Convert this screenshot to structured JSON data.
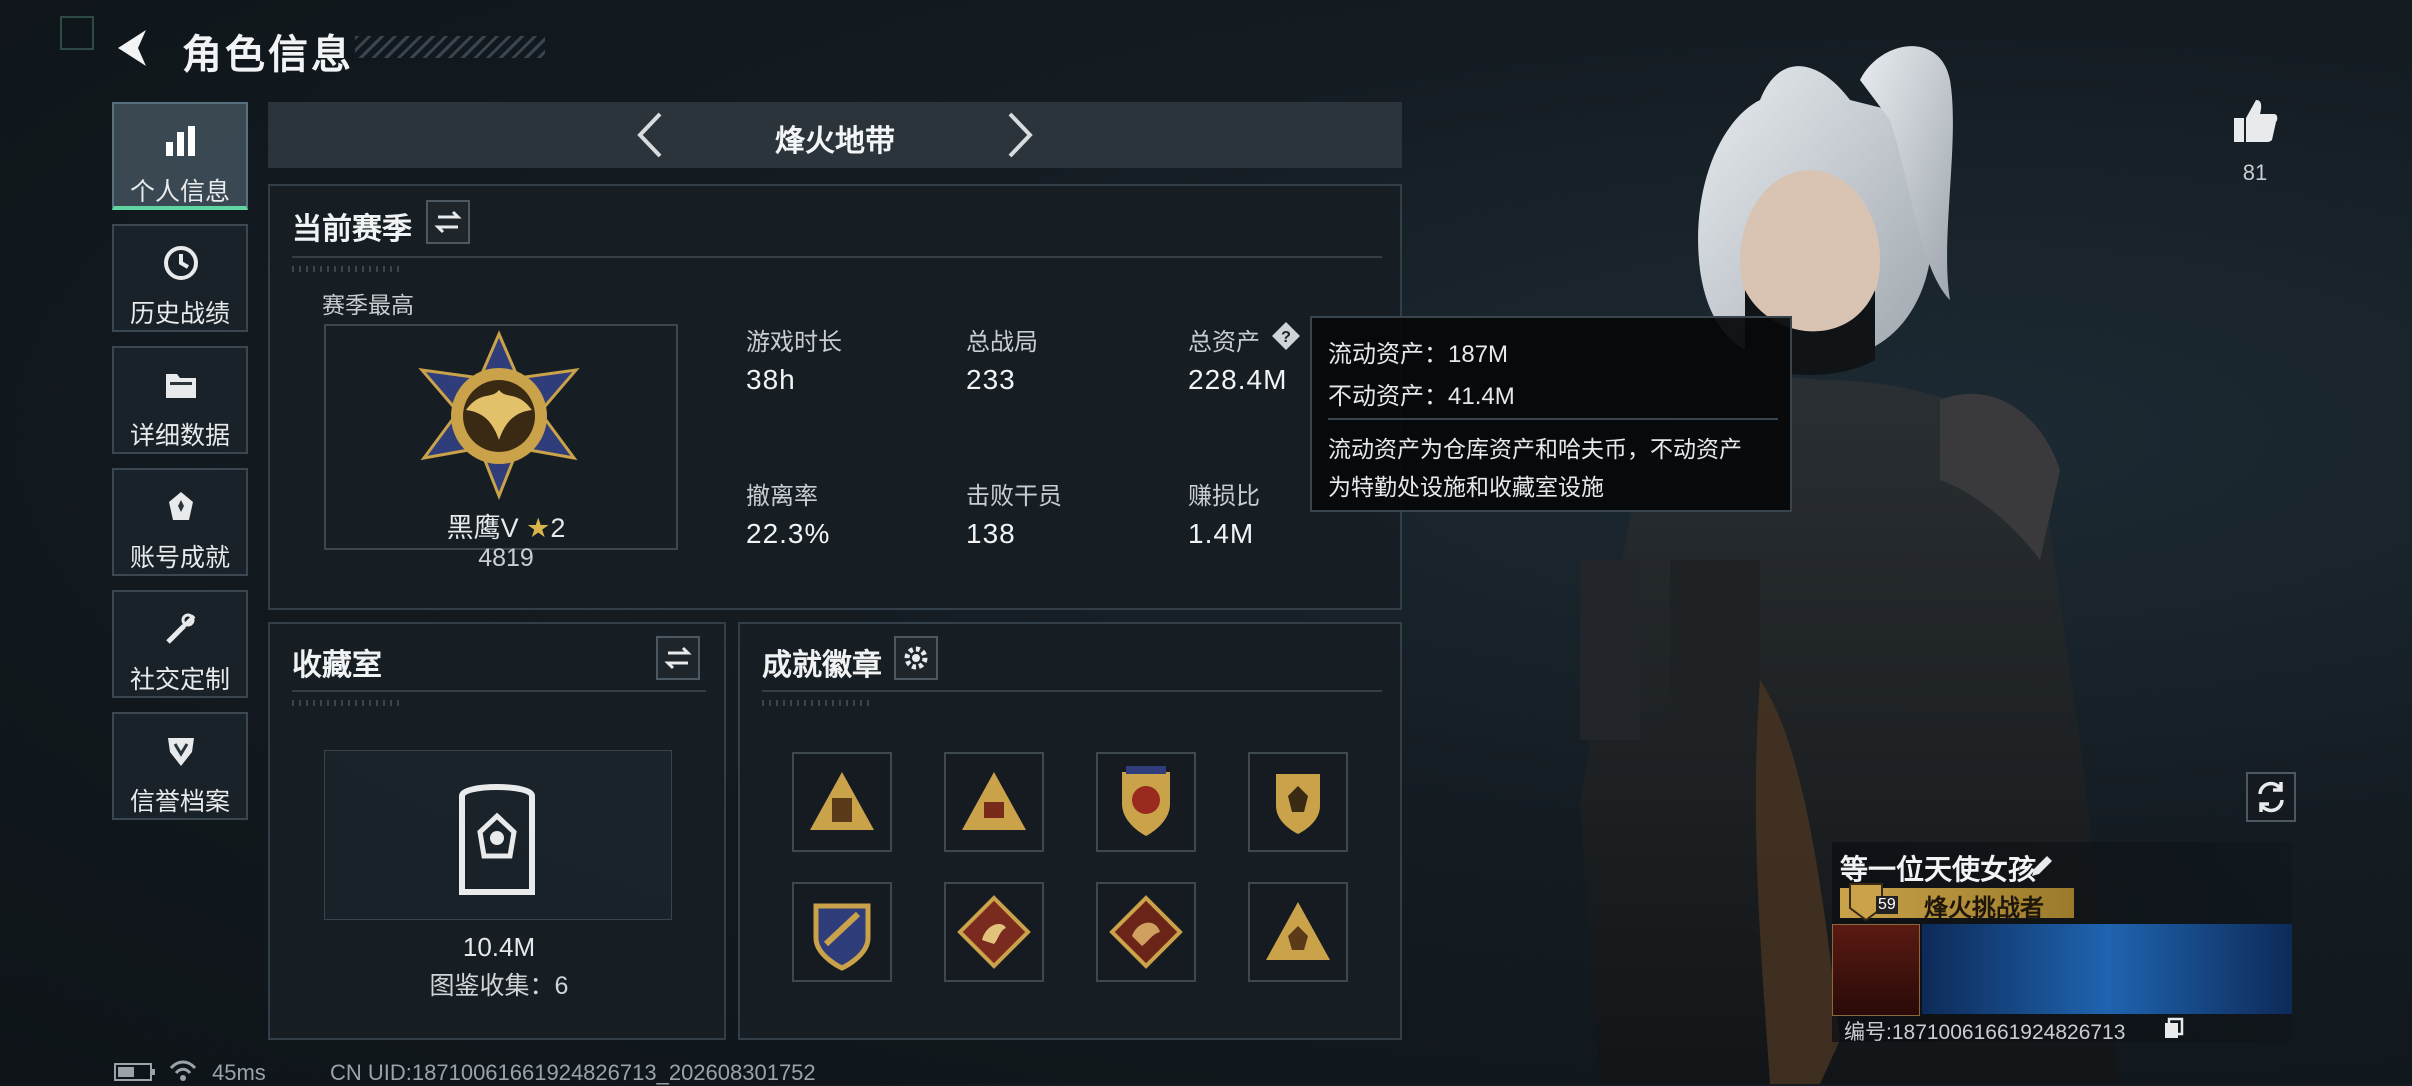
{
  "header": {
    "title": "角色信息"
  },
  "side_nav": [
    {
      "label": "个人信息",
      "icon": "bar-chart-icon",
      "active": true
    },
    {
      "label": "历史战绩",
      "icon": "history-clock-icon",
      "active": false
    },
    {
      "label": "详细数据",
      "icon": "folder-icon",
      "active": false
    },
    {
      "label": "账号成就",
      "icon": "achievement-icon",
      "active": false
    },
    {
      "label": "社交定制",
      "icon": "wrench-tools-icon",
      "active": false
    },
    {
      "label": "信誉档案",
      "icon": "shield-icon",
      "active": false
    }
  ],
  "mode_tab": {
    "title": "烽火地带"
  },
  "season": {
    "heading": "当前赛季",
    "best_label": "赛季最高",
    "rank_name": "黑鹰V",
    "rank_stars": "2",
    "rank_score": "4819",
    "stats": [
      {
        "label": "游戏时长",
        "value": "38h"
      },
      {
        "label": "总战局",
        "value": "233"
      },
      {
        "label": "总资产",
        "value": "228.4M"
      },
      {
        "label": "撤离率",
        "value": "22.3%"
      },
      {
        "label": "击败干员",
        "value": "138"
      },
      {
        "label": "赚损比",
        "value": "1.4M"
      }
    ]
  },
  "tooltip": {
    "line1": "流动资产：187M",
    "line2": "不动资产：41.4M",
    "desc1": "流动资产为仓库资产和哈夫币，不动资产",
    "desc2": "为特勤处设施和收藏室设施"
  },
  "collection": {
    "heading": "收藏室",
    "value": "10.4M",
    "catalog": "图鉴收集：6"
  },
  "badges": {
    "heading": "成就徽章",
    "count": 8
  },
  "likes": {
    "count": "81"
  },
  "player_card": {
    "name": "等一位天使女孩",
    "title": "烽火挑战者",
    "level": "59",
    "id_text": "编号:1871006166192482671​3"
  },
  "status_bar": {
    "ping": "45ms",
    "uid": "CN UID:1871006166192482671​3_202608301752"
  },
  "colors": {
    "accent": "#5fd6a0",
    "gold": "#c9a24a",
    "panel": "#171e24"
  }
}
